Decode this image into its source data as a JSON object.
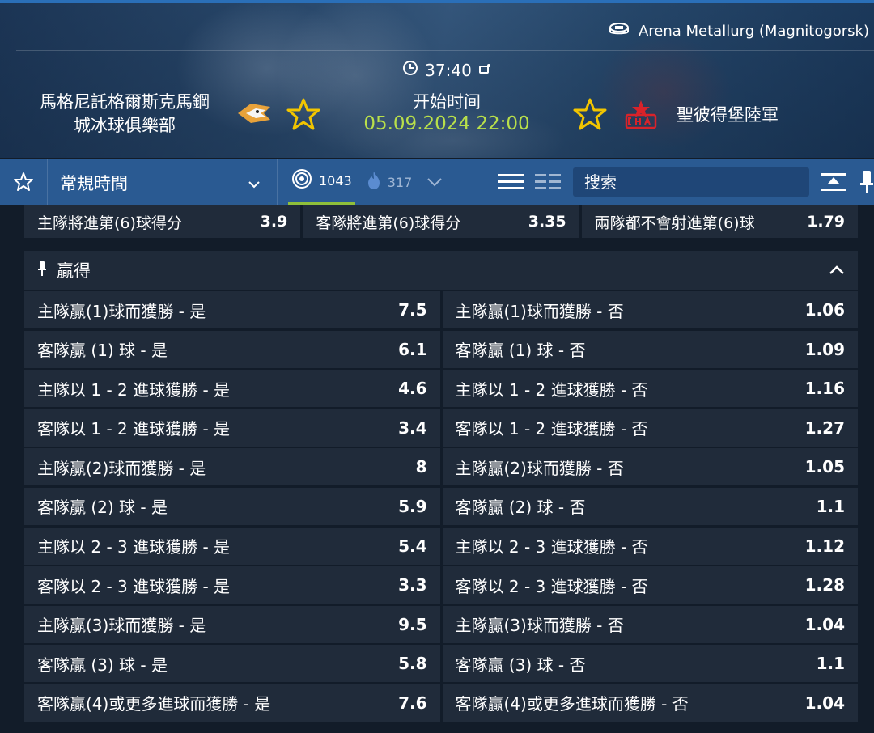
{
  "match": {
    "venue": "Arena Metallurg (Magnitogorsk)",
    "home_team_line1": "馬格尼託格爾斯克馬鋼",
    "home_team_line2": "城冰球俱樂部",
    "away_team": "聖彼得堡陸軍",
    "timer": "37:40",
    "start_label": "开始时间",
    "start_time": "05.09.2024 22:00",
    "colors": {
      "accent_green": "#b9e04a",
      "star_yellow": "#f2c500"
    }
  },
  "toolbar": {
    "period_select": "常規時間",
    "live_count": "1043",
    "hot_count": "317",
    "search_placeholder": "搜索"
  },
  "prev_row": [
    {
      "label": "主隊將進第(6)球得分",
      "odd": "3.9"
    },
    {
      "label": "客隊將進第(6)球得分",
      "odd": "3.35"
    },
    {
      "label": "兩隊都不會射進第(6)球",
      "odd": "1.79"
    }
  ],
  "section": {
    "title": "贏得",
    "rows": [
      [
        {
          "label": "主隊贏(1)球而獲勝 - 是",
          "odd": "7.5"
        },
        {
          "label": "主隊贏(1)球而獲勝 - 否",
          "odd": "1.06"
        }
      ],
      [
        {
          "label": "客隊贏 (1) 球 - 是",
          "odd": "6.1"
        },
        {
          "label": "客隊贏 (1) 球 - 否",
          "odd": "1.09"
        }
      ],
      [
        {
          "label": "主隊以 1 - 2 進球獲勝 - 是",
          "odd": "4.6"
        },
        {
          "label": "主隊以 1 - 2 進球獲勝 - 否",
          "odd": "1.16"
        }
      ],
      [
        {
          "label": "客隊以 1 - 2 進球獲勝 - 是",
          "odd": "3.4"
        },
        {
          "label": "客隊以 1 - 2 進球獲勝 - 否",
          "odd": "1.27"
        }
      ],
      [
        {
          "label": "主隊贏(2)球而獲勝 - 是",
          "odd": "8"
        },
        {
          "label": "主隊贏(2)球而獲勝 - 否",
          "odd": "1.05"
        }
      ],
      [
        {
          "label": "客隊贏 (2) 球 - 是",
          "odd": "5.9"
        },
        {
          "label": "客隊贏 (2) 球 - 否",
          "odd": "1.1"
        }
      ],
      [
        {
          "label": "主隊以 2 - 3 進球獲勝 - 是",
          "odd": "5.4"
        },
        {
          "label": "主隊以 2 - 3 進球獲勝 - 否",
          "odd": "1.12"
        }
      ],
      [
        {
          "label": "客隊以 2 - 3 進球獲勝 - 是",
          "odd": "3.3"
        },
        {
          "label": "客隊以 2 - 3 進球獲勝 - 否",
          "odd": "1.28"
        }
      ],
      [
        {
          "label": "主隊贏(3)球而獲勝 - 是",
          "odd": "9.5"
        },
        {
          "label": "主隊贏(3)球而獲勝 - 否",
          "odd": "1.04"
        }
      ],
      [
        {
          "label": "客隊贏 (3) 球 - 是",
          "odd": "5.8"
        },
        {
          "label": "客隊贏 (3) 球 - 否",
          "odd": "1.1"
        }
      ],
      [
        {
          "label": "客隊贏(4)或更多進球而獲勝 - 是",
          "odd": "7.6"
        },
        {
          "label": "客隊贏(4)或更多進球而獲勝 - 否",
          "odd": "1.04"
        }
      ]
    ]
  }
}
